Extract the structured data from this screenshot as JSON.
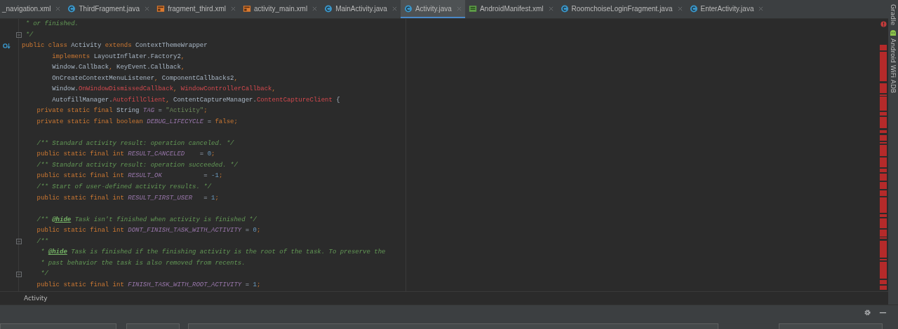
{
  "tabs": [
    {
      "label": "_navigation.xml",
      "kind": "plain",
      "selected": false
    },
    {
      "label": "ThirdFragment.java",
      "kind": "java",
      "selected": false
    },
    {
      "label": "fragment_third.xml",
      "kind": "layout",
      "selected": false
    },
    {
      "label": "activity_main.xml",
      "kind": "layout",
      "selected": false
    },
    {
      "label": "MainActivity.java",
      "kind": "java",
      "selected": false
    },
    {
      "label": "Activity.java",
      "kind": "java",
      "selected": true
    },
    {
      "label": "AndroidManifest.xml",
      "kind": "manifest",
      "selected": false
    },
    {
      "label": "RoomchoiseLoginFragment.java",
      "kind": "java",
      "selected": false
    },
    {
      "label": "EnterActivity.java",
      "kind": "java",
      "selected": false
    }
  ],
  "code_lines": [
    {
      "kind": "code",
      "tokens": [
        {
          "kind": "c",
          "t": " * or finished."
        }
      ]
    },
    {
      "kind": "fold",
      "tokens": [
        {
          "kind": "c",
          "t": " */"
        }
      ]
    },
    {
      "kind": "override",
      "tokens": [
        {
          "kind": "kw",
          "t": "public class "
        },
        {
          "kind": "p",
          "t": "Activity "
        },
        {
          "kind": "kw",
          "t": "extends "
        },
        {
          "kind": "p",
          "t": "ContextThemeWrapper"
        }
      ]
    },
    {
      "kind": "code",
      "tokens": [
        {
          "kind": "kw",
          "t": "        implements "
        },
        {
          "kind": "p",
          "t": "LayoutInflater.Factory2"
        },
        {
          "kind": "kw",
          "t": ","
        }
      ]
    },
    {
      "kind": "code",
      "tokens": [
        {
          "kind": "p",
          "t": "        Window.Callback"
        },
        {
          "kind": "kw",
          "t": ", "
        },
        {
          "kind": "p",
          "t": "KeyEvent.Callback"
        },
        {
          "kind": "kw",
          "t": ","
        }
      ]
    },
    {
      "kind": "code",
      "tokens": [
        {
          "kind": "p",
          "t": "        OnCreateContextMenuListener"
        },
        {
          "kind": "kw",
          "t": ", "
        },
        {
          "kind": "p",
          "t": "ComponentCallbacks2"
        },
        {
          "kind": "kw",
          "t": ","
        }
      ]
    },
    {
      "kind": "code",
      "tokens": [
        {
          "kind": "p",
          "t": "        Window."
        },
        {
          "kind": "err",
          "t": "OnWindowDismissedCallback"
        },
        {
          "kind": "kw",
          "t": ", "
        },
        {
          "kind": "err",
          "t": "WindowControllerCallback"
        },
        {
          "kind": "kw",
          "t": ","
        }
      ]
    },
    {
      "kind": "code",
      "tokens": [
        {
          "kind": "p",
          "t": "        AutofillManager."
        },
        {
          "kind": "err",
          "t": "AutofillClient"
        },
        {
          "kind": "kw",
          "t": ", "
        },
        {
          "kind": "p",
          "t": "ContentCaptureManager."
        },
        {
          "kind": "err",
          "t": "ContentCaptureClient"
        },
        {
          "kind": "p",
          "t": " {"
        }
      ]
    },
    {
      "kind": "code",
      "tokens": [
        {
          "kind": "kw",
          "t": "    private static final "
        },
        {
          "kind": "p",
          "t": "String "
        },
        {
          "kind": "const",
          "t": "TAG"
        },
        {
          "kind": "p",
          "t": " = "
        },
        {
          "kind": "str",
          "t": "\"Activity\""
        },
        {
          "kind": "kw",
          "t": ";"
        }
      ]
    },
    {
      "kind": "code",
      "tokens": [
        {
          "kind": "kw",
          "t": "    private static final boolean "
        },
        {
          "kind": "const",
          "t": "DEBUG_LIFECYCLE"
        },
        {
          "kind": "p",
          "t": " = "
        },
        {
          "kind": "kw",
          "t": "false;"
        }
      ]
    },
    {
      "kind": "blank"
    },
    {
      "kind": "code",
      "tokens": [
        {
          "kind": "c",
          "t": "    /** Standard activity result: operation canceled. */"
        }
      ]
    },
    {
      "kind": "code",
      "tokens": [
        {
          "kind": "kw",
          "t": "    public static final int "
        },
        {
          "kind": "const",
          "t": "RESULT_CANCELED"
        },
        {
          "kind": "p",
          "t": "    = "
        },
        {
          "kind": "num",
          "t": "0"
        },
        {
          "kind": "kw",
          "t": ";"
        }
      ]
    },
    {
      "kind": "code",
      "tokens": [
        {
          "kind": "c",
          "t": "    /** Standard activity result: operation succeeded. */"
        }
      ]
    },
    {
      "kind": "code",
      "tokens": [
        {
          "kind": "kw",
          "t": "    public static final int "
        },
        {
          "kind": "const",
          "t": "RESULT_OK"
        },
        {
          "kind": "p",
          "t": "           = "
        },
        {
          "kind": "num",
          "t": "-1"
        },
        {
          "kind": "kw",
          "t": ";"
        }
      ]
    },
    {
      "kind": "code",
      "tokens": [
        {
          "kind": "c",
          "t": "    /** Start of user-defined activity results. */"
        }
      ]
    },
    {
      "kind": "code",
      "tokens": [
        {
          "kind": "kw",
          "t": "    public static final int "
        },
        {
          "kind": "const",
          "t": "RESULT_FIRST_USER"
        },
        {
          "kind": "p",
          "t": "   = "
        },
        {
          "kind": "num",
          "t": "1"
        },
        {
          "kind": "kw",
          "t": ";"
        }
      ]
    },
    {
      "kind": "blank"
    },
    {
      "kind": "code",
      "tokens": [
        {
          "kind": "c",
          "t": "    /** "
        },
        {
          "kind": "tag",
          "t": "@hide"
        },
        {
          "kind": "c",
          "t": " Task isn't finished when activity is finished */"
        }
      ]
    },
    {
      "kind": "code",
      "tokens": [
        {
          "kind": "kw",
          "t": "    public static final int "
        },
        {
          "kind": "const",
          "t": "DONT_FINISH_TASK_WITH_ACTIVITY"
        },
        {
          "kind": "p",
          "t": " = "
        },
        {
          "kind": "num",
          "t": "0"
        },
        {
          "kind": "kw",
          "t": ";"
        }
      ]
    },
    {
      "kind": "fold",
      "tokens": [
        {
          "kind": "c",
          "t": "    /**"
        }
      ]
    },
    {
      "kind": "code",
      "tokens": [
        {
          "kind": "c",
          "t": "     * "
        },
        {
          "kind": "tag",
          "t": "@hide"
        },
        {
          "kind": "c",
          "t": " Task is finished if the finishing activity is the root of the task. To preserve the"
        }
      ]
    },
    {
      "kind": "code",
      "tokens": [
        {
          "kind": "c",
          "t": "     * past behavior the task is also removed from recents."
        }
      ]
    },
    {
      "kind": "fold",
      "tokens": [
        {
          "kind": "c",
          "t": "     */"
        }
      ]
    },
    {
      "kind": "code",
      "tokens": [
        {
          "kind": "kw",
          "t": "    public static final int "
        },
        {
          "kind": "const",
          "t": "FINISH_TASK_WITH_ROOT_ACTIVITY"
        },
        {
          "kind": "p",
          "t": " = "
        },
        {
          "kind": "num",
          "t": "1"
        },
        {
          "kind": "kw",
          "t": ";"
        }
      ]
    }
  ],
  "breadcrumb": "Activity",
  "tool_strip": [
    "Gradle",
    "Android WiFi ADB"
  ]
}
